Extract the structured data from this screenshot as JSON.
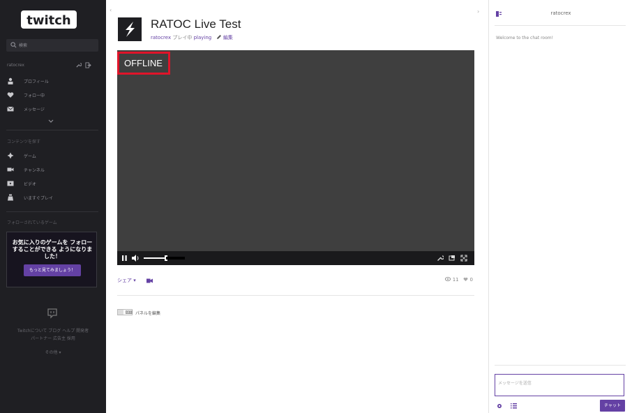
{
  "brand": {
    "logo_text": "twitch",
    "accent": "#6441a4",
    "sidebar_bg": "#1f1f23",
    "offline_border": "#e0142a"
  },
  "sidebar": {
    "search_placeholder": "検索",
    "username": "ratocrex",
    "user_icons": [
      "wrench-icon",
      "logout-icon"
    ],
    "user_items": [
      {
        "icon": "person-icon",
        "label": "プロフィール"
      },
      {
        "icon": "heart-icon",
        "label": "フォロー中"
      },
      {
        "icon": "mail-icon",
        "label": "メッセージ"
      }
    ],
    "browse_label": "コンテンツを探す",
    "browse_items": [
      {
        "icon": "games-icon",
        "label": "ゲーム"
      },
      {
        "icon": "camera-icon",
        "label": "チャンネル"
      },
      {
        "icon": "video-icon",
        "label": "ビデオ"
      },
      {
        "icon": "controller-icon",
        "label": "いますぐプレイ"
      }
    ],
    "followed_games_label": "フォローされているゲーム",
    "promo": {
      "text": "お気に入りのゲームを フォローすることができる ようになりました！",
      "button": "もっと見てみましょう！"
    },
    "footer_line1": "Twitchについて ブログ ヘルプ 開発者",
    "footer_line2": "パートナー 広告主 採用",
    "footer_more": "その他 ▾"
  },
  "channel": {
    "title": "RATOC Live Test",
    "streamer": "ratocrex",
    "playing_text": "プレイ中",
    "game": "playing",
    "edit_label": "編集"
  },
  "player": {
    "status": "OFFLINE",
    "volume_fraction": 0.55
  },
  "below_player": {
    "share_label": "シェア ▾",
    "viewers": "11",
    "hearts": "0",
    "panel_toggle": "OFF",
    "panel_edit_label": "パネルを編集"
  },
  "chat": {
    "title": "ratocrex",
    "welcome": "Welcome to the chat room!",
    "input_placeholder": "メッセージを送信",
    "send_button": "チャット"
  }
}
